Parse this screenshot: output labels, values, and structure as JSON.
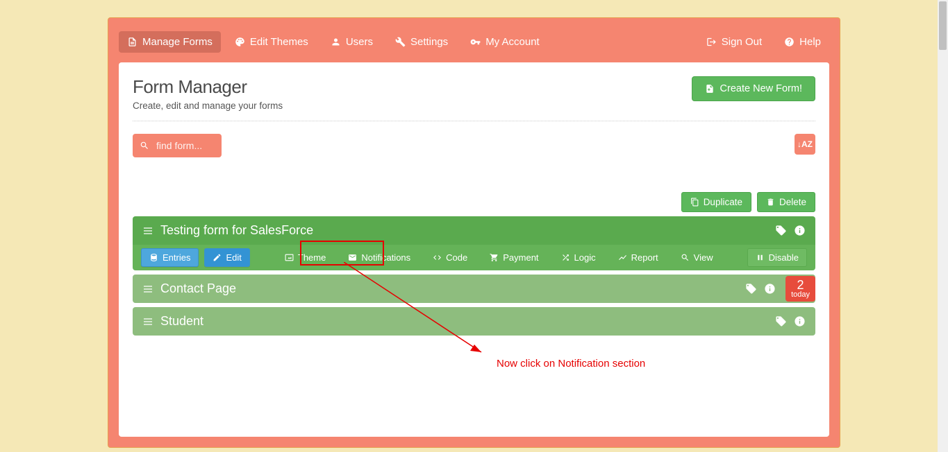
{
  "nav": {
    "left": [
      {
        "label": "Manage Forms",
        "icon": "file"
      },
      {
        "label": "Edit Themes",
        "icon": "palette"
      },
      {
        "label": "Users",
        "icon": "user"
      },
      {
        "label": "Settings",
        "icon": "wrench"
      },
      {
        "label": "My Account",
        "icon": "key"
      }
    ],
    "right": [
      {
        "label": "Sign Out",
        "icon": "signout"
      },
      {
        "label": "Help",
        "icon": "question"
      }
    ]
  },
  "page": {
    "title": "Form Manager",
    "subtitle": "Create, edit and manage your forms",
    "create_button": "Create New Form!"
  },
  "search": {
    "placeholder": "find form..."
  },
  "sort_label": "↓AZ",
  "actions": {
    "duplicate": "Duplicate",
    "delete": "Delete"
  },
  "forms": [
    {
      "title": "Testing form for SalesForce",
      "active": true
    },
    {
      "title": "Contact Page",
      "active": false,
      "today_count": "2",
      "today_label": "today"
    },
    {
      "title": "Student",
      "active": false
    }
  ],
  "toolbar": {
    "entries": "Entries",
    "edit": "Edit",
    "theme": "Theme",
    "notifications": "Notifications",
    "code": "Code",
    "payment": "Payment",
    "logic": "Logic",
    "report": "Report",
    "view": "View",
    "disable": "Disable"
  },
  "annotation": "Now click on Notification section"
}
